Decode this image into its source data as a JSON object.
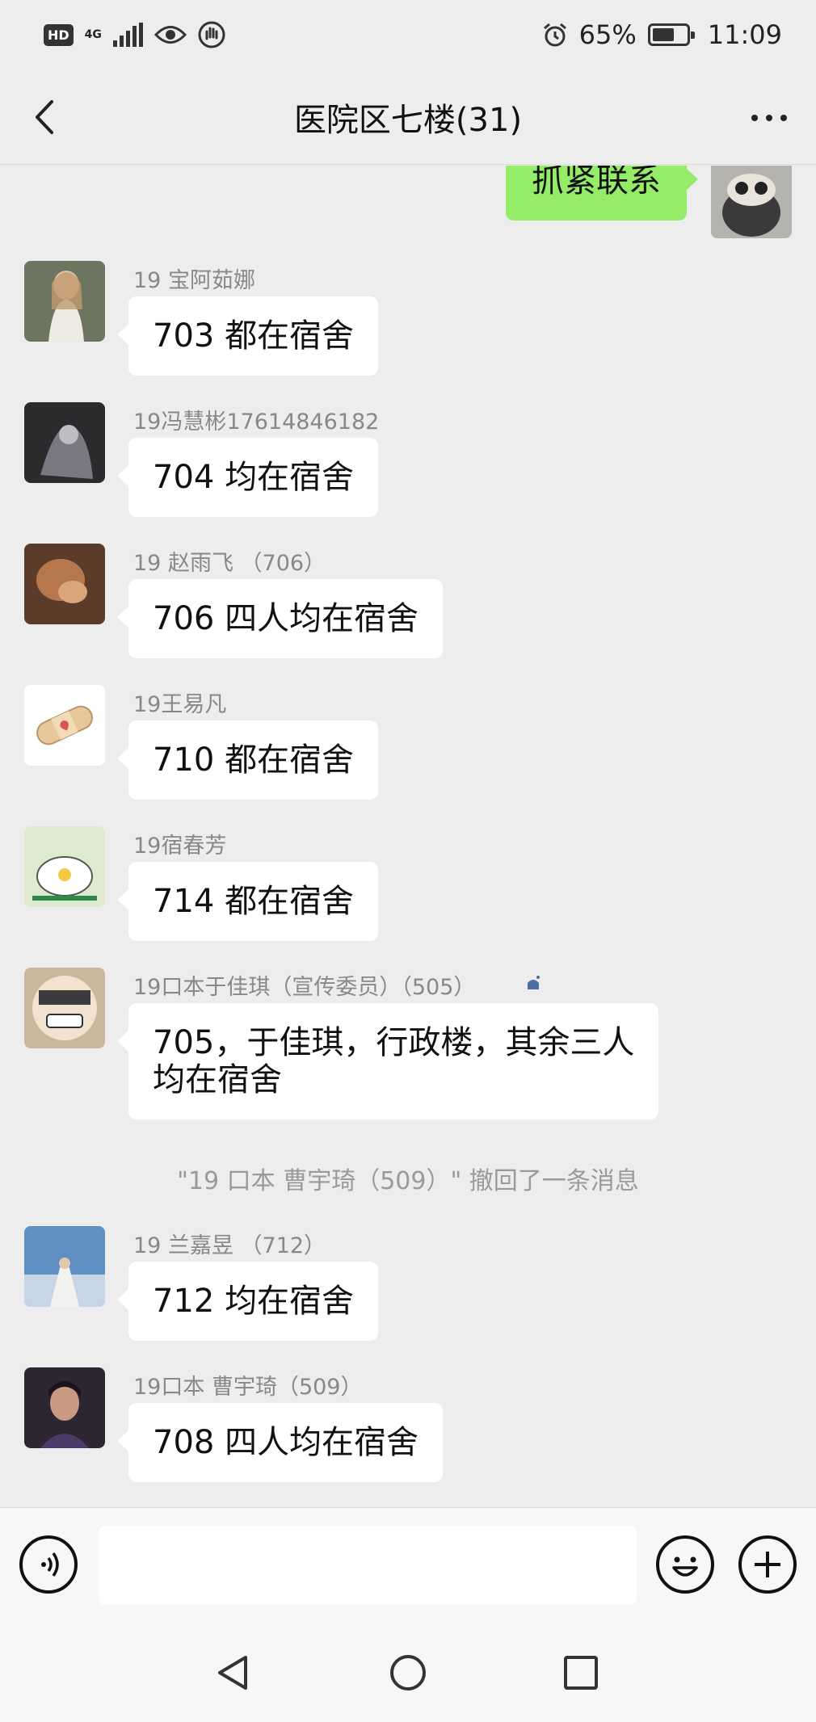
{
  "status_bar": {
    "hd": "HD",
    "network": "4G",
    "battery": "65%",
    "battery_level": 0.65,
    "time": "11:09",
    "icons": [
      "signal-icon",
      "eye-icon",
      "hand-icon",
      "alarm-icon",
      "battery-icon"
    ]
  },
  "header": {
    "title": "医院区七楼(31)",
    "back_icon": "chevron-left-icon",
    "more_icon": "more-dots-icon"
  },
  "messages": [
    {
      "type": "sent",
      "text": "抓紧联系"
    },
    {
      "type": "received",
      "sender": "19 宝阿茹娜",
      "text": "703 都在宿舍"
    },
    {
      "type": "received",
      "sender": "19冯慧彬17614846182",
      "text": "704 均在宿舍"
    },
    {
      "type": "received",
      "sender": "19  赵雨飞 （706）",
      "text": "706 四人均在宿舍"
    },
    {
      "type": "received",
      "sender": "19王易凡",
      "text": "710 都在宿舍"
    },
    {
      "type": "received",
      "sender": "19宿春芳",
      "text": "714 都在宿舍"
    },
    {
      "type": "received",
      "sender": "19口本于佳琪（宣传委员）（505）",
      "text_lines": [
        "705，于佳琪，行政楼，其余三人",
        "均在宿舍"
      ]
    },
    {
      "type": "system",
      "text": "\"19 口本 曹宇琦（509）\" 撤回了一条消息"
    },
    {
      "type": "received",
      "sender": "19 兰嘉昱   （712）",
      "text": "712 均在宿舍"
    },
    {
      "type": "received",
      "sender": "19口本 曹宇琦（509）",
      "text": "708 四人均在宿舍"
    }
  ],
  "input_bar": {
    "voice_icon": "voice-icon",
    "emoji_icon": "emoji-icon",
    "plus_icon": "plus-icon",
    "text_value": ""
  },
  "system_nav": {
    "icons": [
      "back-triangle-icon",
      "home-circle-icon",
      "recents-square-icon"
    ]
  }
}
